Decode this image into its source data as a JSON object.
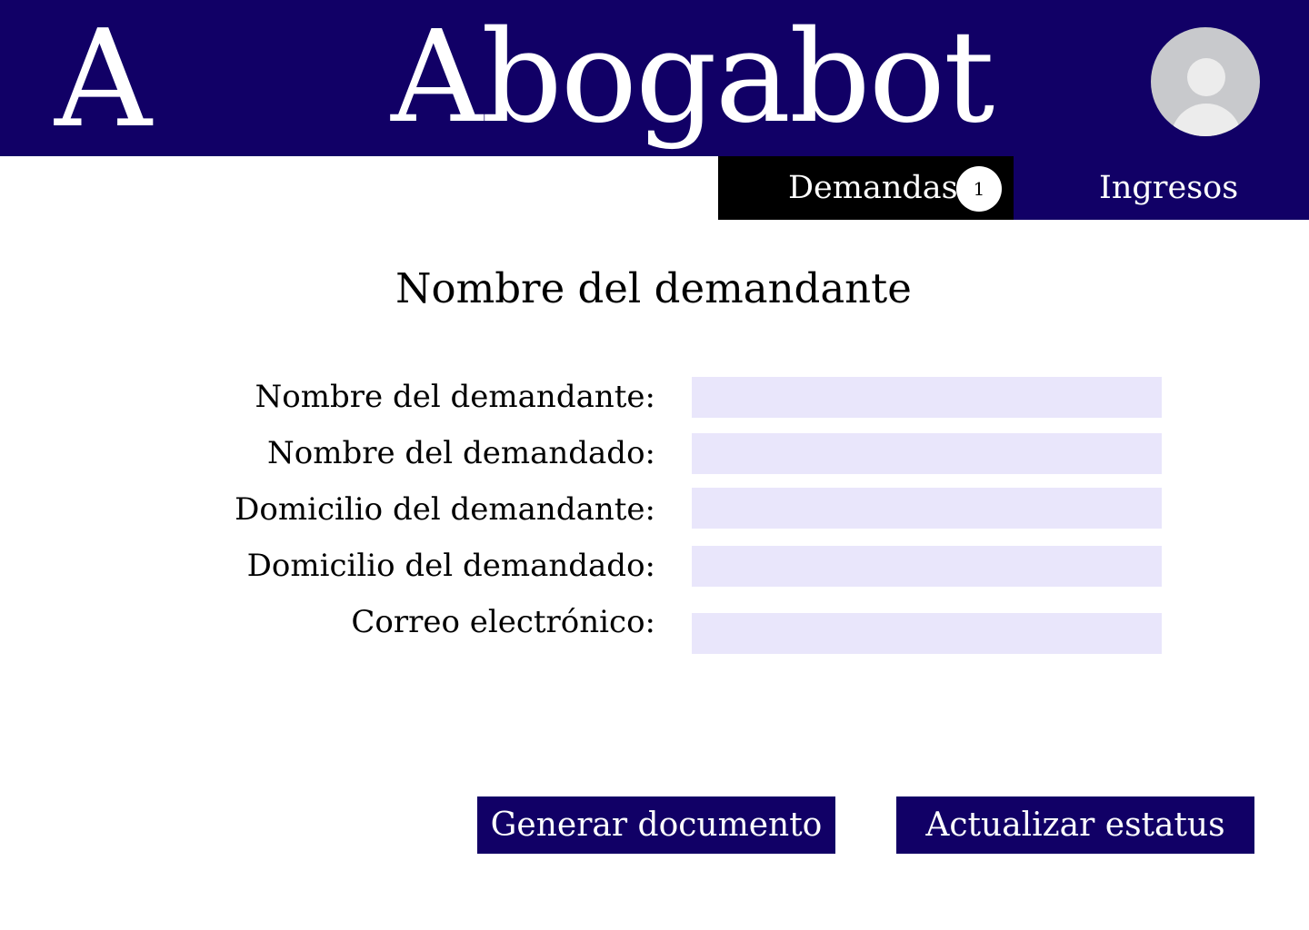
{
  "header": {
    "logo_letter": "A",
    "app_title": "Abogabot",
    "avatar_icon": "user-avatar-icon"
  },
  "nav": {
    "tabs": [
      {
        "label": "Demandas",
        "badge": "1",
        "active": true
      },
      {
        "label": "Ingresos",
        "active": false
      }
    ]
  },
  "main": {
    "title": "Nombre del demandante",
    "fields": [
      {
        "label": "Nombre del demandante:",
        "value": ""
      },
      {
        "label": "Nombre del demandado:",
        "value": ""
      },
      {
        "label": "Domicilio del demandante:",
        "value": ""
      },
      {
        "label": "Domicilio del demandado:",
        "value": ""
      },
      {
        "label": "Correo electrónico:",
        "value": ""
      }
    ]
  },
  "actions": {
    "generate_label": "Generar documento",
    "update_label": "Actualizar estatus"
  },
  "colors": {
    "brand": "#110066",
    "active_tab": "#000000",
    "input_bg": "#e9e6fb"
  }
}
